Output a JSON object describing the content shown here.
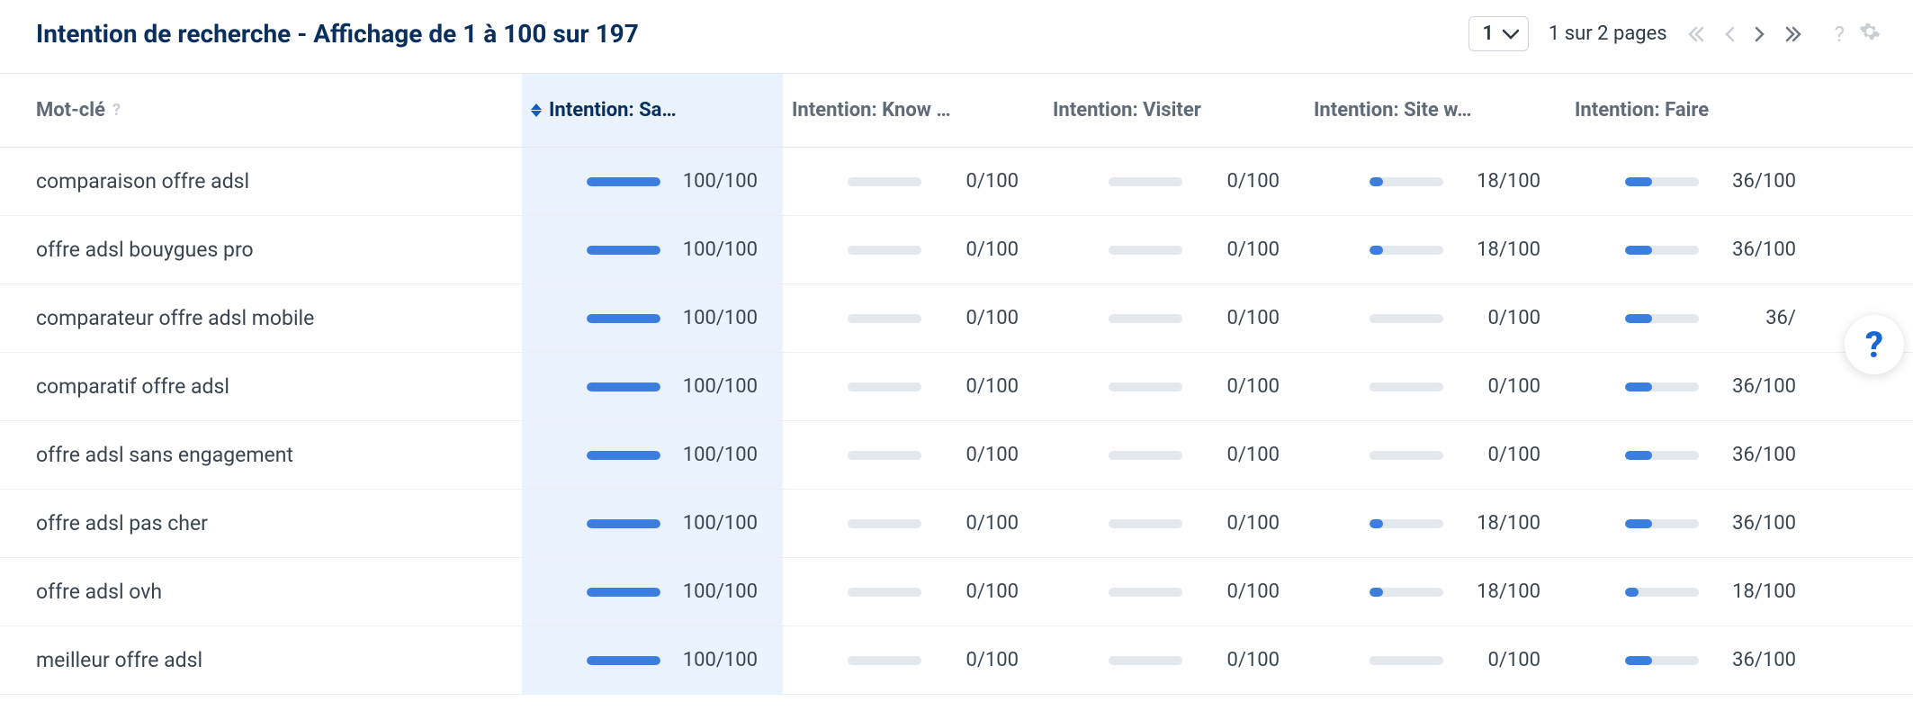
{
  "title": "Intention de recherche - Affichage de 1 à 100 sur 197",
  "pager": {
    "current_page": "1",
    "page_text": "1 sur 2 pages"
  },
  "columns": {
    "keyword": "Mot-clé",
    "savoir": "Intention: Sa…",
    "know": "Intention: Know …",
    "visiter": "Intention: Visiter",
    "siteweb": "Intention: Site w…",
    "faire": "Intention: Faire"
  },
  "rows": [
    {
      "keyword": "comparaison offre adsl",
      "savoir": {
        "v": 100,
        "t": "100/100"
      },
      "know": {
        "v": 0,
        "t": "0/100"
      },
      "visiter": {
        "v": 0,
        "t": "0/100"
      },
      "siteweb": {
        "v": 18,
        "t": "18/100"
      },
      "faire": {
        "v": 36,
        "t": "36/100"
      }
    },
    {
      "keyword": "offre adsl bouygues pro",
      "savoir": {
        "v": 100,
        "t": "100/100"
      },
      "know": {
        "v": 0,
        "t": "0/100"
      },
      "visiter": {
        "v": 0,
        "t": "0/100"
      },
      "siteweb": {
        "v": 18,
        "t": "18/100"
      },
      "faire": {
        "v": 36,
        "t": "36/100"
      }
    },
    {
      "keyword": "comparateur offre adsl mobile",
      "savoir": {
        "v": 100,
        "t": "100/100"
      },
      "know": {
        "v": 0,
        "t": "0/100"
      },
      "visiter": {
        "v": 0,
        "t": "0/100"
      },
      "siteweb": {
        "v": 0,
        "t": "0/100"
      },
      "faire": {
        "v": 36,
        "t": "36/"
      }
    },
    {
      "keyword": "comparatif offre adsl",
      "savoir": {
        "v": 100,
        "t": "100/100"
      },
      "know": {
        "v": 0,
        "t": "0/100"
      },
      "visiter": {
        "v": 0,
        "t": "0/100"
      },
      "siteweb": {
        "v": 0,
        "t": "0/100"
      },
      "faire": {
        "v": 36,
        "t": "36/100"
      }
    },
    {
      "keyword": "offre adsl sans engagement",
      "savoir": {
        "v": 100,
        "t": "100/100"
      },
      "know": {
        "v": 0,
        "t": "0/100"
      },
      "visiter": {
        "v": 0,
        "t": "0/100"
      },
      "siteweb": {
        "v": 0,
        "t": "0/100"
      },
      "faire": {
        "v": 36,
        "t": "36/100"
      }
    },
    {
      "keyword": "offre adsl pas cher",
      "savoir": {
        "v": 100,
        "t": "100/100"
      },
      "know": {
        "v": 0,
        "t": "0/100"
      },
      "visiter": {
        "v": 0,
        "t": "0/100"
      },
      "siteweb": {
        "v": 18,
        "t": "18/100"
      },
      "faire": {
        "v": 36,
        "t": "36/100"
      }
    },
    {
      "keyword": "offre adsl ovh",
      "savoir": {
        "v": 100,
        "t": "100/100"
      },
      "know": {
        "v": 0,
        "t": "0/100"
      },
      "visiter": {
        "v": 0,
        "t": "0/100"
      },
      "siteweb": {
        "v": 18,
        "t": "18/100"
      },
      "faire": {
        "v": 18,
        "t": "18/100"
      }
    },
    {
      "keyword": "meilleur offre adsl",
      "savoir": {
        "v": 100,
        "t": "100/100"
      },
      "know": {
        "v": 0,
        "t": "0/100"
      },
      "visiter": {
        "v": 0,
        "t": "0/100"
      },
      "siteweb": {
        "v": 0,
        "t": "0/100"
      },
      "faire": {
        "v": 36,
        "t": "36/100"
      }
    }
  ]
}
